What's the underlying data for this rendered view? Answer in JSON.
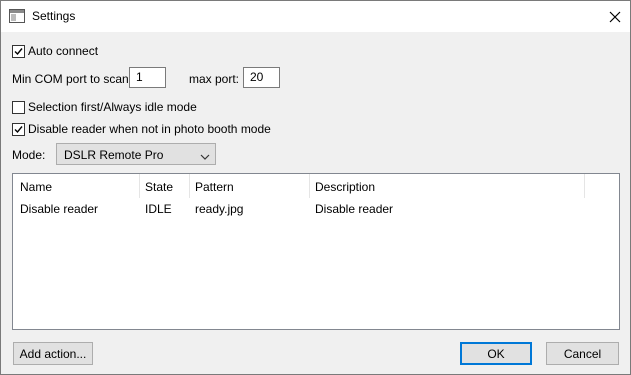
{
  "window": {
    "title": "Settings"
  },
  "auto_connect": {
    "label": "Auto connect",
    "checked": true
  },
  "ports": {
    "min_label": "Min COM port to scan:",
    "min_value": "1",
    "max_label": "max port:",
    "max_value": "20"
  },
  "selection_first": {
    "label": "Selection first/Always idle mode",
    "checked": false
  },
  "disable_reader": {
    "label": "Disable reader when not in photo booth mode",
    "checked": true
  },
  "mode": {
    "label": "Mode:",
    "value": "DSLR Remote Pro"
  },
  "table": {
    "columns": [
      "Name",
      "State",
      "Pattern",
      "Description"
    ],
    "rows": [
      {
        "name": "Disable reader",
        "state": "IDLE",
        "pattern": "ready.jpg",
        "description": "Disable reader"
      }
    ]
  },
  "buttons": {
    "add_action": "Add action...",
    "ok": "OK",
    "cancel": "Cancel"
  },
  "icons": {
    "app": "window-icon",
    "close": "close-icon",
    "check": "checkmark-icon",
    "dropdown": "chevron-down-icon"
  },
  "colors": {
    "accent": "#0078d7",
    "dialog_bg": "#f0f0f0"
  }
}
